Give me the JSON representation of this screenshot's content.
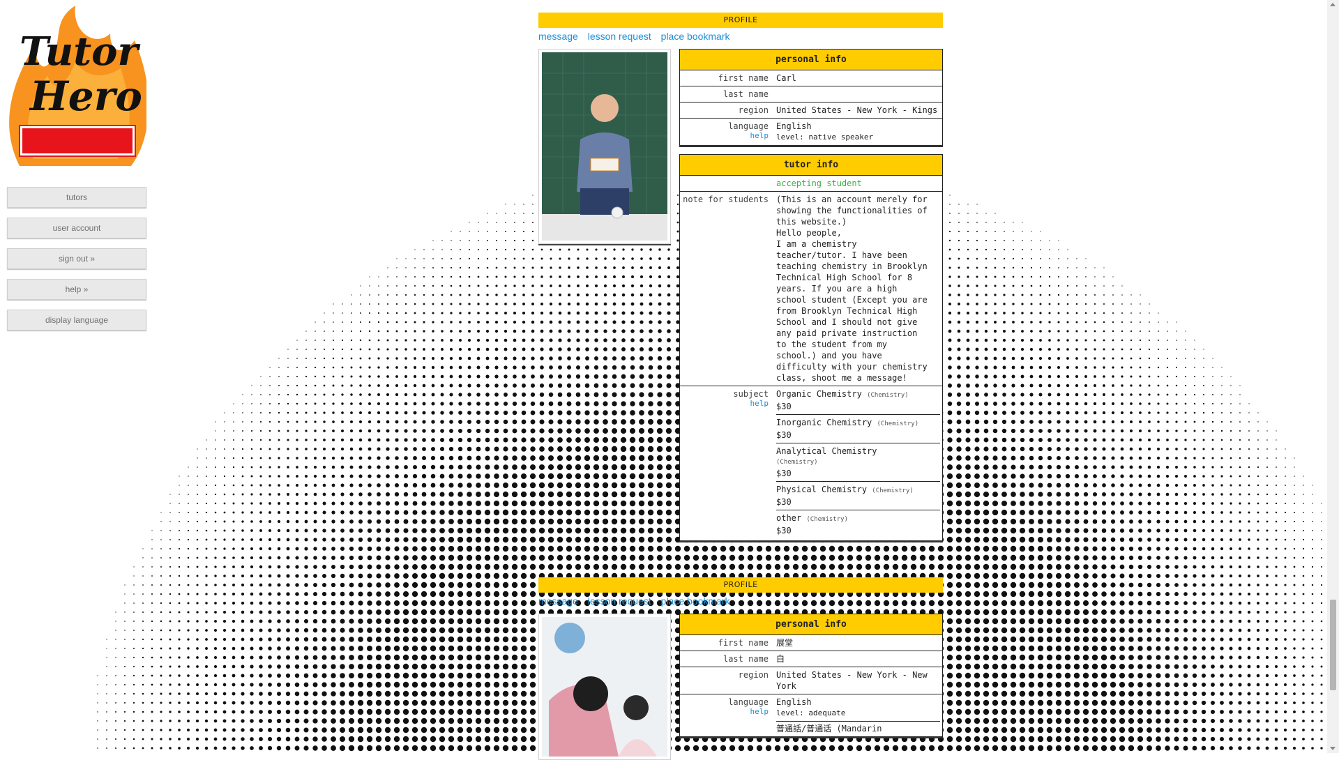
{
  "sidebar": {
    "nav": [
      "tutors",
      "user account",
      "sign out »",
      "help »",
      "display language"
    ]
  },
  "profiles": [
    {
      "bar_title": "PROFILE",
      "links": {
        "message": "message",
        "lesson_request": "lesson request",
        "bookmark": "place bookmark"
      },
      "personal_title": "personal info",
      "first_name_label": "first name",
      "first_name": "Carl",
      "last_name_label": "last name",
      "last_name": "",
      "region_label": "region",
      "region": "United States - New York - Kings",
      "language_label": "language",
      "help": "help",
      "language": "English",
      "language_level": "level: native speaker",
      "tutor_title": "tutor info",
      "status": "accepting student",
      "note_label": "note for students",
      "note_lines": [
        "(This is an account merely for",
        "showing the functionalities of",
        "this website.)",
        "Hello people,",
        "I am a chemistry",
        "teacher/tutor. I have been",
        "teaching chemistry in Brooklyn",
        "Technical High School for 8",
        "years. If you are a high",
        "school student (Except you are",
        "from Brooklyn Technical High",
        "School and I should not give",
        "any paid private instruction",
        "to the student from my",
        "school.) and you have",
        "difficulty with your chemistry",
        "class, shoot me a message!"
      ],
      "subject_label": "subject",
      "subjects": [
        {
          "name": "Organic Chemistry",
          "category": "(Chemistry)",
          "price": "$30"
        },
        {
          "name": "Inorganic Chemistry",
          "category": "(Chemistry)",
          "price": "$30"
        },
        {
          "name": "Analytical Chemistry",
          "category": "(Chemistry)",
          "price": "$30"
        },
        {
          "name": "Physical Chemistry",
          "category": "(Chemistry)",
          "price": "$30"
        },
        {
          "name": "other",
          "category": "(Chemistry)",
          "price": "$30"
        }
      ]
    },
    {
      "bar_title": "PROFILE",
      "links": {
        "message": "message",
        "lesson_request": "lesson request",
        "bookmark": "place bookmark"
      },
      "personal_title": "personal info",
      "first_name_label": "first name",
      "first_name": "展堂",
      "last_name_label": "last name",
      "last_name": "白",
      "region_label": "region",
      "region": "United States - New York - New York",
      "language_label": "language",
      "help": "help",
      "language": "English",
      "language_level": "level: adequate",
      "language2": "普通話/普通话 (Mandarin"
    }
  ],
  "colors": {
    "accent": "#ffcc00",
    "link": "#1a8fd8",
    "status": "#3cb043"
  }
}
